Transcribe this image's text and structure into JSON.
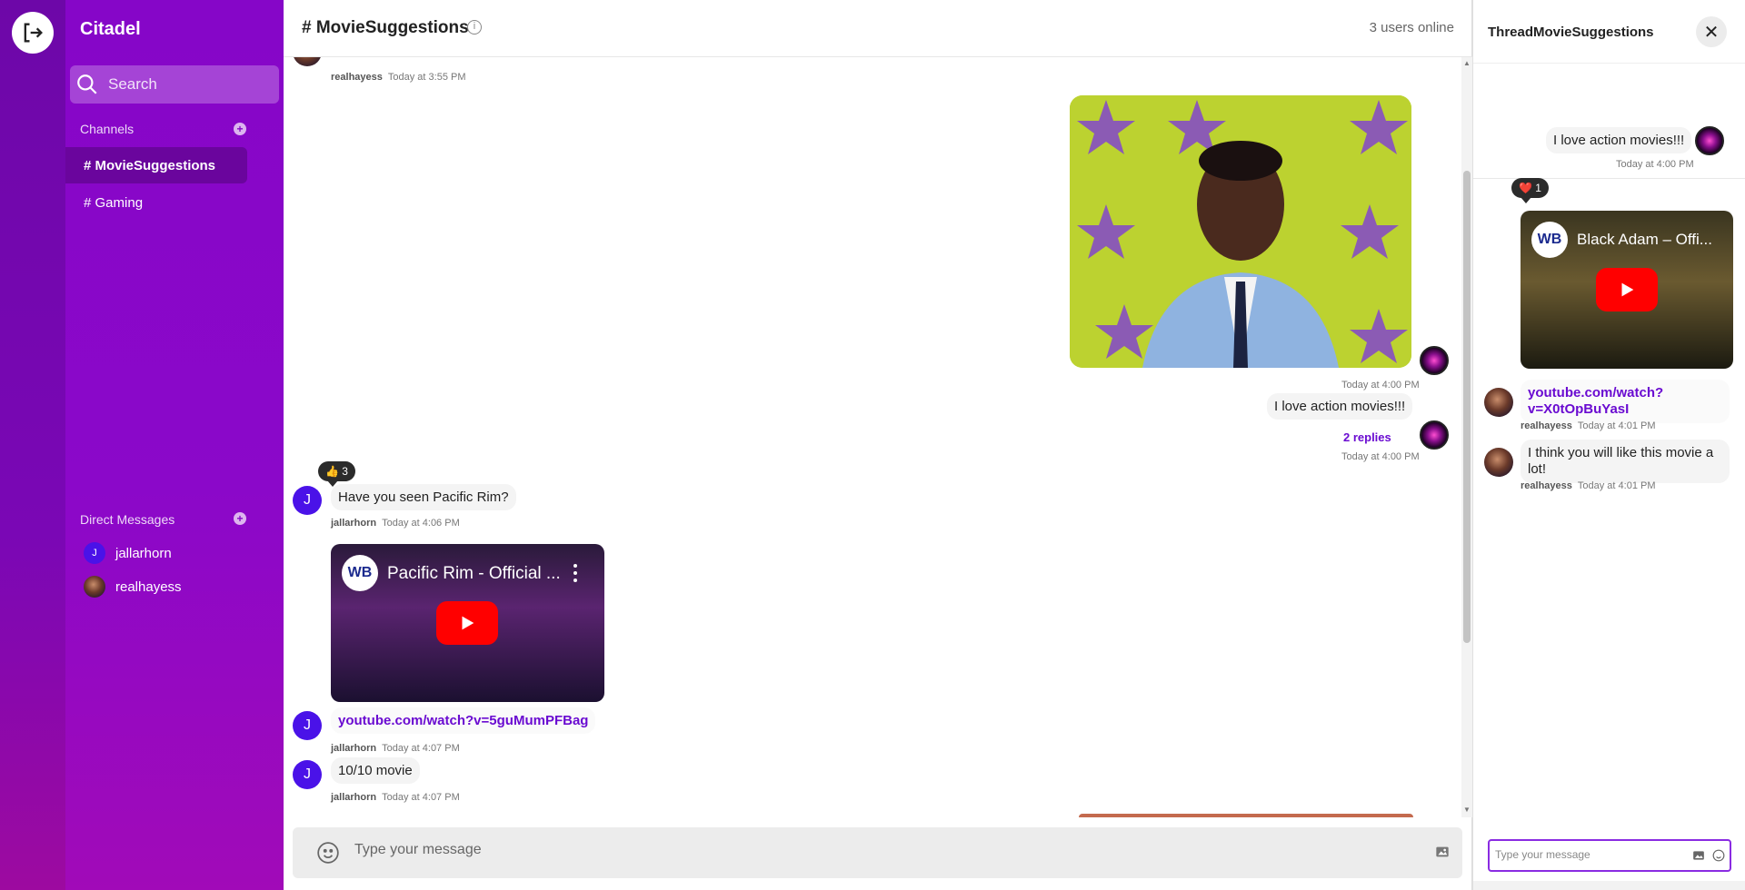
{
  "brand": "Citadel",
  "search": {
    "placeholder": "Search"
  },
  "channels": {
    "title": "Channels",
    "items": [
      {
        "label": "# MovieSuggestions"
      },
      {
        "label": "# Gaming"
      }
    ]
  },
  "dms": {
    "title": "Direct Messages",
    "items": [
      {
        "label": "jallarhorn",
        "initial": "J"
      },
      {
        "label": "realhayess"
      }
    ]
  },
  "header": {
    "title": "# MovieSuggestions",
    "online": "3 users online"
  },
  "messages": {
    "m0": {
      "user": "realhayess",
      "time": "Today at 3:55 PM"
    },
    "m1": {
      "time": "Today at 4:00 PM"
    },
    "m2": {
      "text": "I love action movies!!!",
      "replies": "2 replies",
      "time": "Today at 4:00 PM"
    },
    "m3": {
      "reaction": "👍 3",
      "text": "Have you seen Pacific Rim?",
      "user": "jallarhorn",
      "time": "Today at 4:06 PM",
      "initial": "J"
    },
    "m4": {
      "video_title": "Pacific Rim - Official ...",
      "link": "youtube.com/watch?v=5guMumPFBag",
      "user": "jallarhorn",
      "time": "Today at 4:07 PM",
      "initial": "J"
    },
    "m5": {
      "text": "10/10 movie",
      "user": "jallarhorn",
      "time": "Today at 4:07 PM",
      "initial": "J"
    }
  },
  "composer": {
    "placeholder": "Type your message"
  },
  "thread": {
    "title": "ThreadMovieSuggestions",
    "parent": {
      "text": "I love action movies!!!",
      "time": "Today at 4:00 PM"
    },
    "reaction": "❤️ 1",
    "video_title": "Black Adam – Offi...",
    "replies": [
      {
        "link": "youtube.com/watch?v=X0tOpBuYasI",
        "user": "realhayess",
        "time": "Today at 4:01 PM"
      },
      {
        "text": "I think you will like this movie a lot!",
        "user": "realhayess",
        "time": "Today at 4:01 PM"
      }
    ],
    "composer_placeholder": "Type your message"
  },
  "colors": {
    "accent": "#8606c8",
    "rail": "#6d07a8",
    "link": "#6a0bd1",
    "avatar_j": "#4a12e8"
  }
}
